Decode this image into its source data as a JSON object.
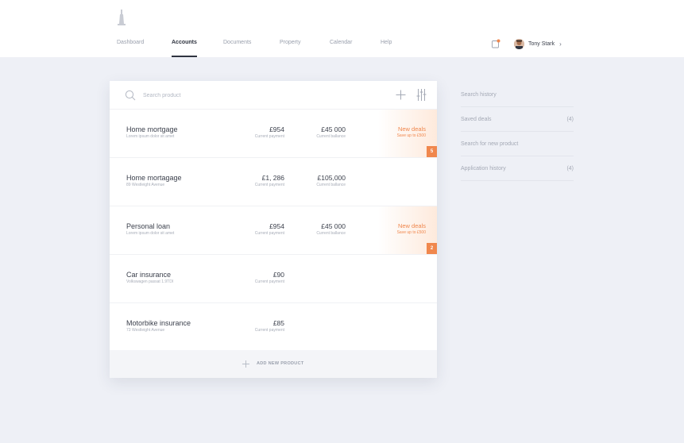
{
  "nav": {
    "items": [
      {
        "label": "Dashboard",
        "active": false
      },
      {
        "label": "Accounts",
        "active": true
      },
      {
        "label": "Documents",
        "active": false
      },
      {
        "label": "Property",
        "active": false
      },
      {
        "label": "Calendar",
        "active": false
      },
      {
        "label": "Help",
        "active": false
      }
    ]
  },
  "user": {
    "name": "Tony Stark",
    "chevron": "›"
  },
  "icons": {
    "logo": "tower-logo",
    "notification": "bell-icon",
    "search": "search-icon",
    "add": "plus-icon",
    "filter": "sliders-icon"
  },
  "colors": {
    "accent": "#f0874d",
    "text": "#3a3f4b",
    "muted": "#a8adb8",
    "background": "#eef0f6"
  },
  "search": {
    "placeholder": "Search product"
  },
  "products": [
    {
      "title": "Home mortgage",
      "subtitle": "Lorem ipsum dolor sit amet",
      "payment": "£954",
      "payment_label": "Current payment",
      "balance": "£45 000",
      "balance_label": "Current ballance",
      "deal": {
        "title": "New deals",
        "subtitle": "Save up to £500",
        "count": "5"
      }
    },
    {
      "title": "Home mortagage",
      "subtitle": "89 Westleight Avenue",
      "payment": "£1, 286",
      "payment_label": "Current payment",
      "balance": "£105,000",
      "balance_label": "Current ballance"
    },
    {
      "title": "Personal loan",
      "subtitle": "Lorem ipsum dolor sit amet",
      "payment": "£954",
      "payment_label": "Current payment",
      "balance": "£45 000",
      "balance_label": "Current ballance",
      "deal": {
        "title": "New deals",
        "subtitle": "Save up to £500",
        "count": "2"
      }
    },
    {
      "title": "Car insurance",
      "subtitle": "Volkswagen passat 1.9TDI",
      "payment": "£90",
      "payment_label": "Current payment"
    },
    {
      "title": "Motorbike insurance",
      "subtitle": "73 Westleight Avenue",
      "payment": "£85",
      "payment_label": "Current payment"
    }
  ],
  "add_product": {
    "label": "ADD NEW PRODUCT"
  },
  "sidebar": {
    "items": [
      {
        "label": "Search history",
        "count": ""
      },
      {
        "label": "Saved deals",
        "count": "(4)"
      },
      {
        "label": "Search for new product",
        "count": ""
      },
      {
        "label": "Application history",
        "count": "(4)"
      }
    ]
  }
}
